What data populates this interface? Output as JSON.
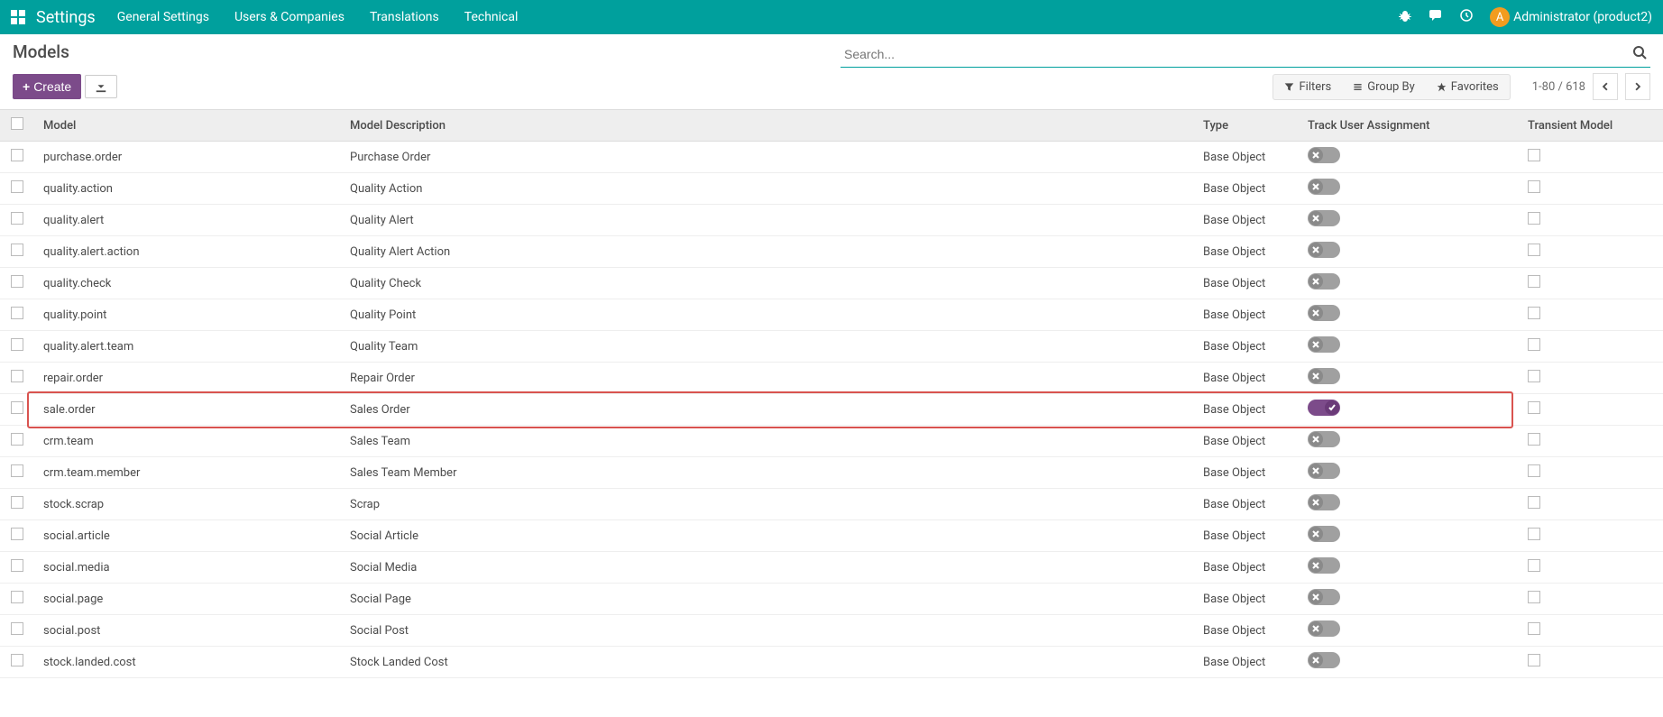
{
  "navbar": {
    "brand": "Settings",
    "links": [
      "General Settings",
      "Users & Companies",
      "Translations",
      "Technical"
    ],
    "userAvatar": "A",
    "userName": "Administrator (product2)"
  },
  "header": {
    "title": "Models",
    "searchPlaceholder": "Search...",
    "createLabel": "Create",
    "filtersLabel": "Filters",
    "groupByLabel": "Group By",
    "favoritesLabel": "Favorites",
    "pager": "1-80 / 618"
  },
  "table": {
    "headers": {
      "model": "Model",
      "description": "Model Description",
      "type": "Type",
      "track": "Track User Assignment",
      "transient": "Transient Model"
    },
    "rows": [
      {
        "model": "purchase.order",
        "desc": "Purchase Order",
        "type": "Base Object",
        "track": false,
        "transient": false,
        "highlight": false
      },
      {
        "model": "quality.action",
        "desc": "Quality Action",
        "type": "Base Object",
        "track": false,
        "transient": false,
        "highlight": false
      },
      {
        "model": "quality.alert",
        "desc": "Quality Alert",
        "type": "Base Object",
        "track": false,
        "transient": false,
        "highlight": false
      },
      {
        "model": "quality.alert.action",
        "desc": "Quality Alert Action",
        "type": "Base Object",
        "track": false,
        "transient": false,
        "highlight": false
      },
      {
        "model": "quality.check",
        "desc": "Quality Check",
        "type": "Base Object",
        "track": false,
        "transient": false,
        "highlight": false
      },
      {
        "model": "quality.point",
        "desc": "Quality Point",
        "type": "Base Object",
        "track": false,
        "transient": false,
        "highlight": false
      },
      {
        "model": "quality.alert.team",
        "desc": "Quality Team",
        "type": "Base Object",
        "track": false,
        "transient": false,
        "highlight": false
      },
      {
        "model": "repair.order",
        "desc": "Repair Order",
        "type": "Base Object",
        "track": false,
        "transient": false,
        "highlight": false
      },
      {
        "model": "sale.order",
        "desc": "Sales Order",
        "type": "Base Object",
        "track": true,
        "transient": false,
        "highlight": true
      },
      {
        "model": "crm.team",
        "desc": "Sales Team",
        "type": "Base Object",
        "track": false,
        "transient": false,
        "highlight": false
      },
      {
        "model": "crm.team.member",
        "desc": "Sales Team Member",
        "type": "Base Object",
        "track": false,
        "transient": false,
        "highlight": false
      },
      {
        "model": "stock.scrap",
        "desc": "Scrap",
        "type": "Base Object",
        "track": false,
        "transient": false,
        "highlight": false
      },
      {
        "model": "social.article",
        "desc": "Social Article",
        "type": "Base Object",
        "track": false,
        "transient": false,
        "highlight": false
      },
      {
        "model": "social.media",
        "desc": "Social Media",
        "type": "Base Object",
        "track": false,
        "transient": false,
        "highlight": false
      },
      {
        "model": "social.page",
        "desc": "Social Page",
        "type": "Base Object",
        "track": false,
        "transient": false,
        "highlight": false
      },
      {
        "model": "social.post",
        "desc": "Social Post",
        "type": "Base Object",
        "track": false,
        "transient": false,
        "highlight": false
      },
      {
        "model": "stock.landed.cost",
        "desc": "Stock Landed Cost",
        "type": "Base Object",
        "track": false,
        "transient": false,
        "highlight": false
      }
    ]
  }
}
